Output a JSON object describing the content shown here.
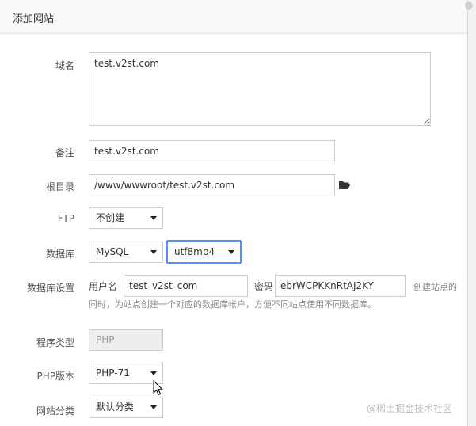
{
  "dialog": {
    "title": "添加网站"
  },
  "form": {
    "domain": {
      "label": "域名",
      "value": "test.v2st.com"
    },
    "remark": {
      "label": "备注",
      "value": "test.v2st.com"
    },
    "root_dir": {
      "label": "根目录",
      "value": "/www/wwwroot/test.v2st.com",
      "icon": "folder-open-icon"
    },
    "ftp": {
      "label": "FTP",
      "selected": "不创建"
    },
    "database": {
      "label": "数据库",
      "type_selected": "MySQL",
      "charset_selected": "utf8mb4"
    },
    "db_settings": {
      "label": "数据库设置",
      "username_label": "用户名",
      "username_value": "test_v2st_com",
      "password_label": "密码",
      "password_value": "ebrWCPKKnRtAJ2KY",
      "hint_tail": "创建站点的",
      "hint_line2": "同时，为站点创建一个对应的数据库帐户，方便不同站点使用不同数据库。"
    },
    "program_type": {
      "label": "程序类型",
      "selected": "PHP"
    },
    "php_version": {
      "label": "PHP版本",
      "selected": "PHP-71"
    },
    "site_category": {
      "label": "网站分类",
      "selected": "默认分类"
    }
  },
  "watermark": "@稀土掘金技术社区",
  "colors": {
    "focus_border": "#4d90fe",
    "titlebar_bg": "#f8f8f8"
  }
}
